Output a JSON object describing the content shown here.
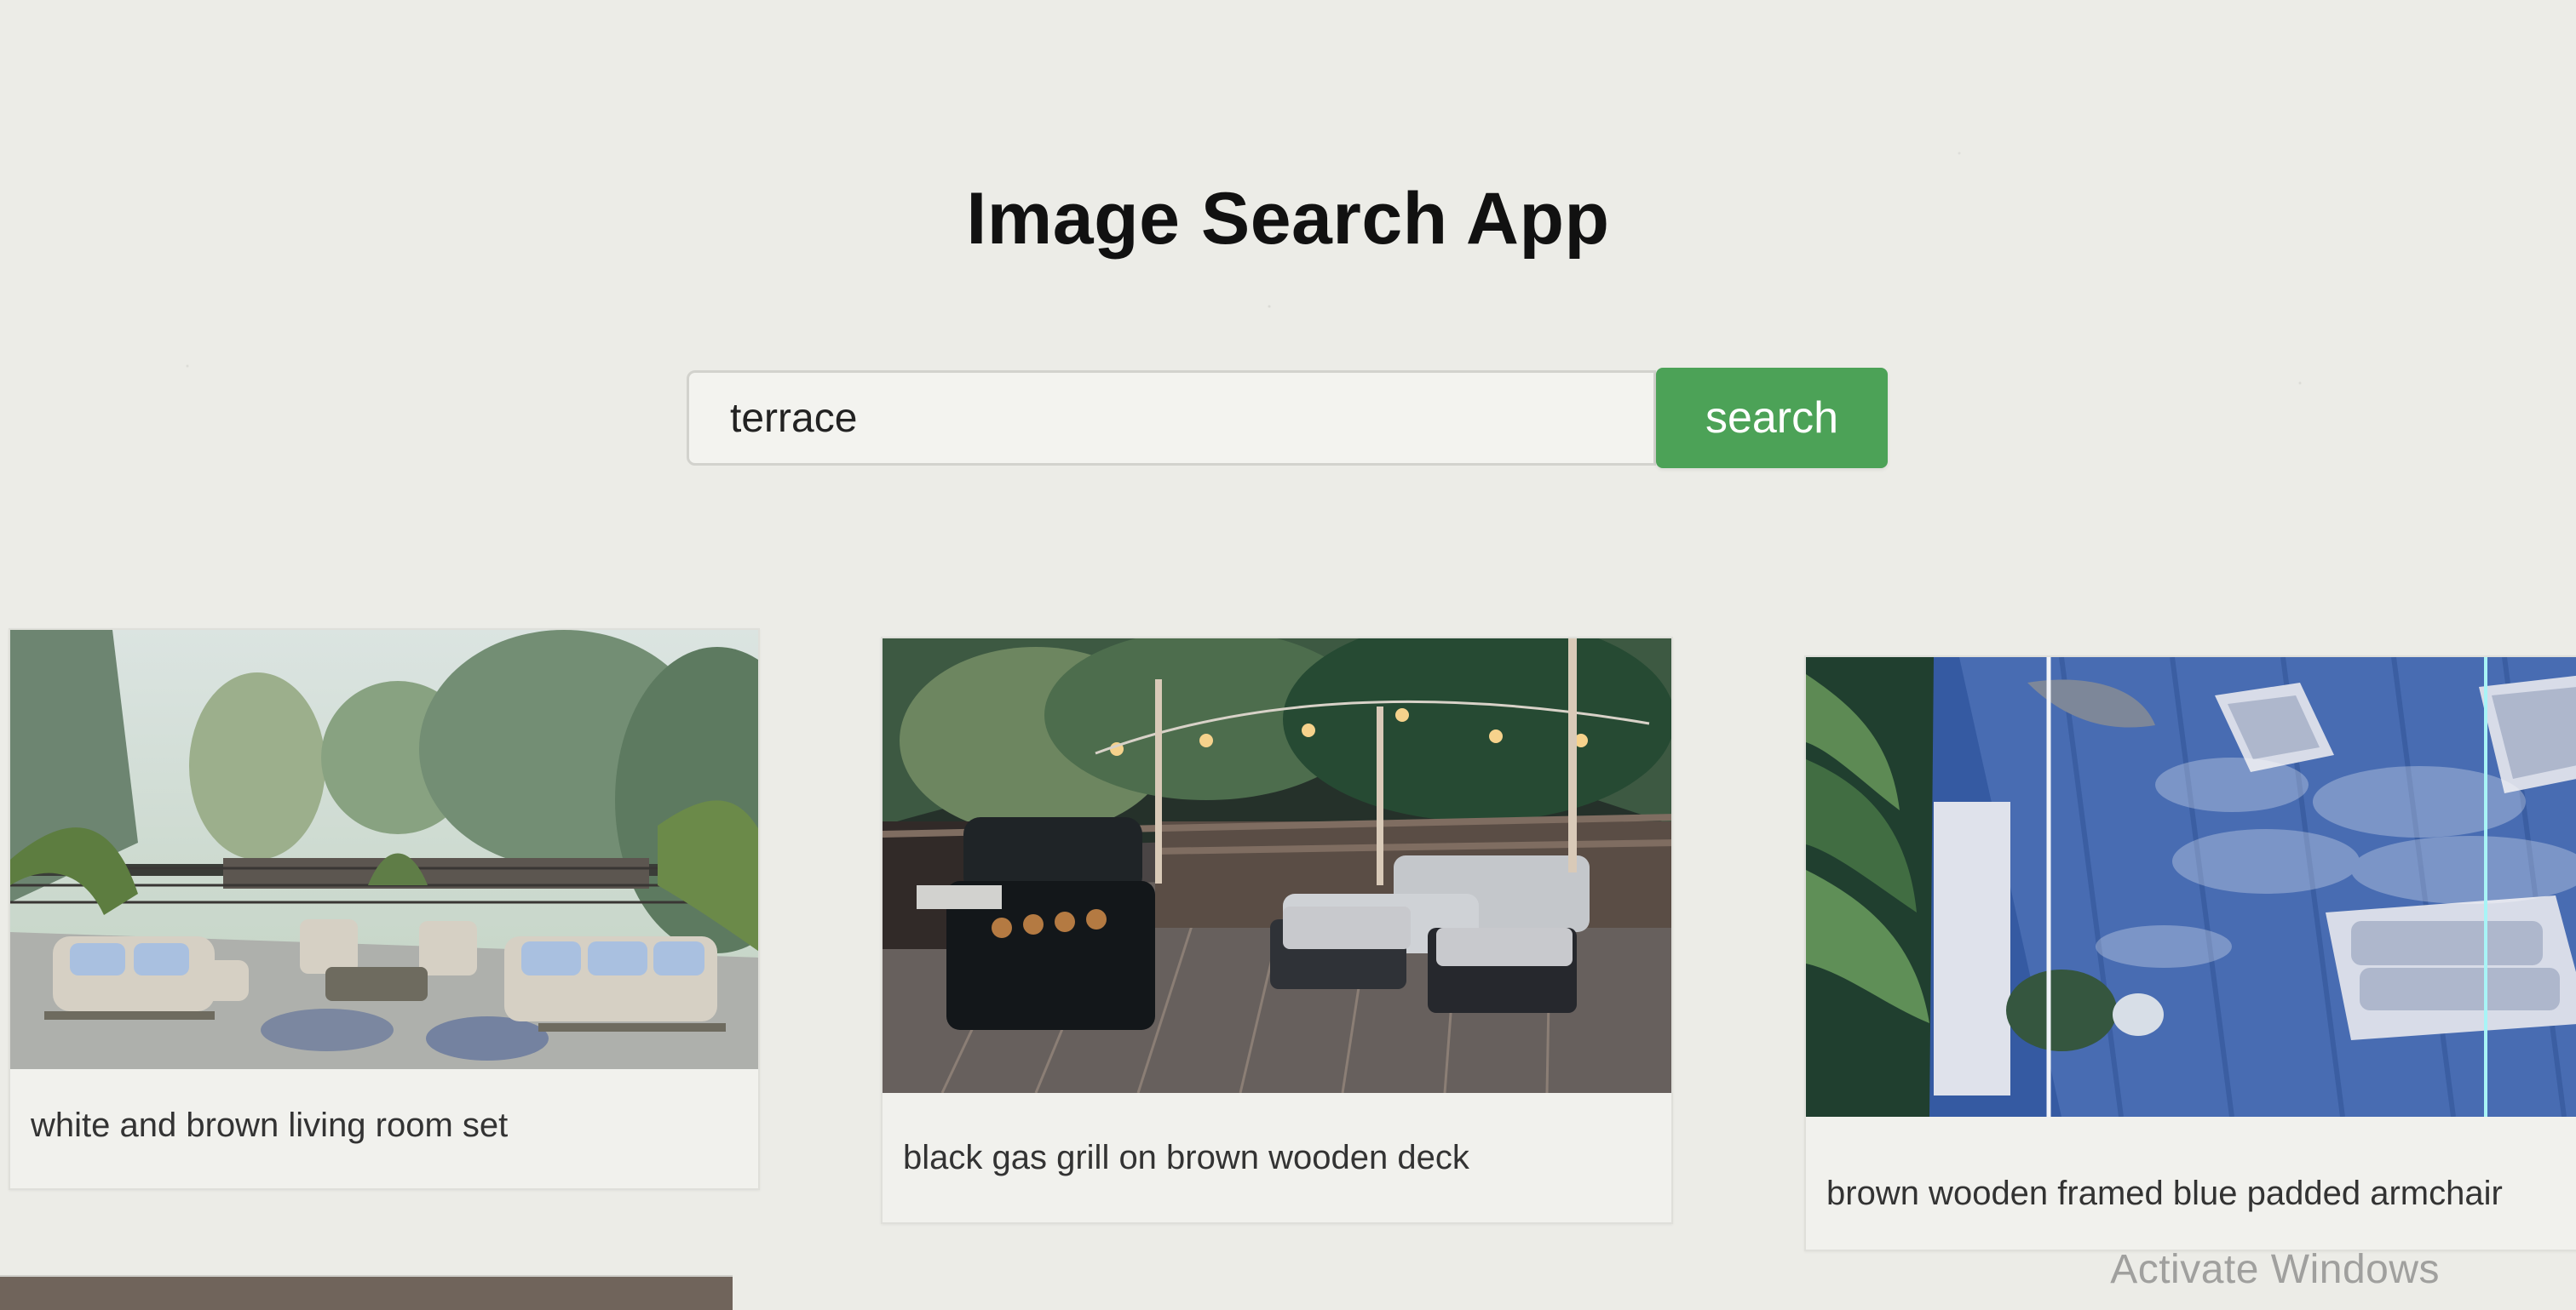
{
  "app": {
    "title": "Image Search App",
    "colors": {
      "background": "#ecece7",
      "search_button": "#4ca257",
      "text": "#111111"
    }
  },
  "search": {
    "value": "terrace",
    "button_label": "search"
  },
  "results": [
    {
      "caption": "white and brown living room set"
    },
    {
      "caption": "black gas grill on brown wooden deck"
    },
    {
      "caption": "brown wooden framed blue padded armchair"
    }
  ],
  "system_overlay": {
    "text": "Activate Windows"
  }
}
